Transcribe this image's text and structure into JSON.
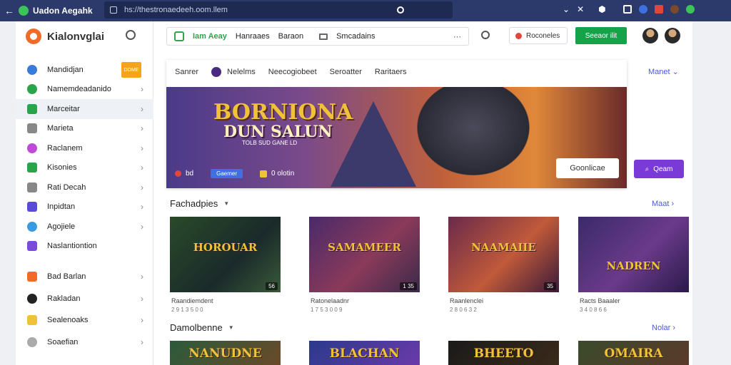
{
  "browser": {
    "tab_title": "Uadon Aegahk",
    "url": "hs://thestronaedeeh.oom.llem",
    "icons": [
      "back-icon",
      "tab-logo-icon",
      "close-icon",
      "globe-icon",
      "reload-icon",
      "chevron-down-icon",
      "close-icon",
      "shield-icon",
      "bookmark-icon",
      "profile-icon",
      "extension-icon",
      "avatar-icon",
      "puzzle-icon"
    ]
  },
  "sidebar": {
    "brand": "Kialonvglai",
    "badge": "DOME",
    "items": [
      {
        "label": "Mandidjan",
        "color": "#3a7ad8"
      },
      {
        "label": "Namemdeadanido",
        "color": "#2aa44a"
      },
      {
        "label": "Marceitar",
        "color": "#2aa44a"
      },
      {
        "label": "Marieta",
        "color": "#888888"
      },
      {
        "label": "Raclanem",
        "color": "#c04ad8"
      },
      {
        "label": "Kisonies",
        "color": "#2aa44a"
      },
      {
        "label": "Rati Decah",
        "color": "#888888"
      },
      {
        "label": "Inpidtan",
        "color": "#5a4ad8"
      },
      {
        "label": "Agojiele",
        "color": "#3a9ae0"
      },
      {
        "label": "Naslantiontion",
        "color": "#7a4ad8"
      },
      {
        "label": "Bad Barlan",
        "color": "#f06a2a"
      },
      {
        "label": "Rakladan",
        "color": "#222222"
      },
      {
        "label": "Sealenoaks",
        "color": "#f0c23a"
      },
      {
        "label": "Soaefian",
        "color": "#aaaaaa"
      }
    ]
  },
  "topbar": {
    "chip_active": "Iam Aeay",
    "chip2": "Hanraaes",
    "chip3": "Baraon",
    "chip4": "Smcadains",
    "outline_button": "Roconeles",
    "green_button": "Seeaor ilit"
  },
  "featured": {
    "tabs": [
      "Sanrer",
      "Nelelms",
      "Neecogiobeet",
      "Seroatter",
      "Raritaers"
    ],
    "more": "Manet",
    "hero_title1": "BORNIONA",
    "hero_title2": "DUN SALUN",
    "hero_sub": "TOLB SUD GANE LD",
    "meta_num": "bd",
    "meta_pill": "Gaemer",
    "meta_count": "0 olotin",
    "cta": "Goonlicae",
    "purple_button": "Qeam"
  },
  "sections": [
    {
      "title": "Fachadpies",
      "more": "Maat",
      "cards": [
        {
          "title": "HOROUAR",
          "count": "56",
          "caption": "Raandiemdent",
          "sub": "2 9 1 3 5 0 0"
        },
        {
          "title": "SAMAMEER",
          "count": "1 35",
          "caption": "Ratonelaadnr",
          "sub": "1 7 5 3 0 0 9"
        },
        {
          "title": "NAAMAIIE",
          "count": "35",
          "caption": "Raanlenclei",
          "sub": "2 8 0 6 3 2"
        },
        {
          "title": "NADREN",
          "count": "",
          "caption": "Racts Baaaler",
          "sub": "3 4 0 8 6 6"
        }
      ]
    },
    {
      "title": "Damolbenne",
      "more": "Nolar",
      "cards": [
        {
          "title": "NANUDNE"
        },
        {
          "title": "BLACHAN"
        },
        {
          "title": "BHEETO"
        },
        {
          "title": "OMAIRA"
        }
      ]
    }
  ]
}
